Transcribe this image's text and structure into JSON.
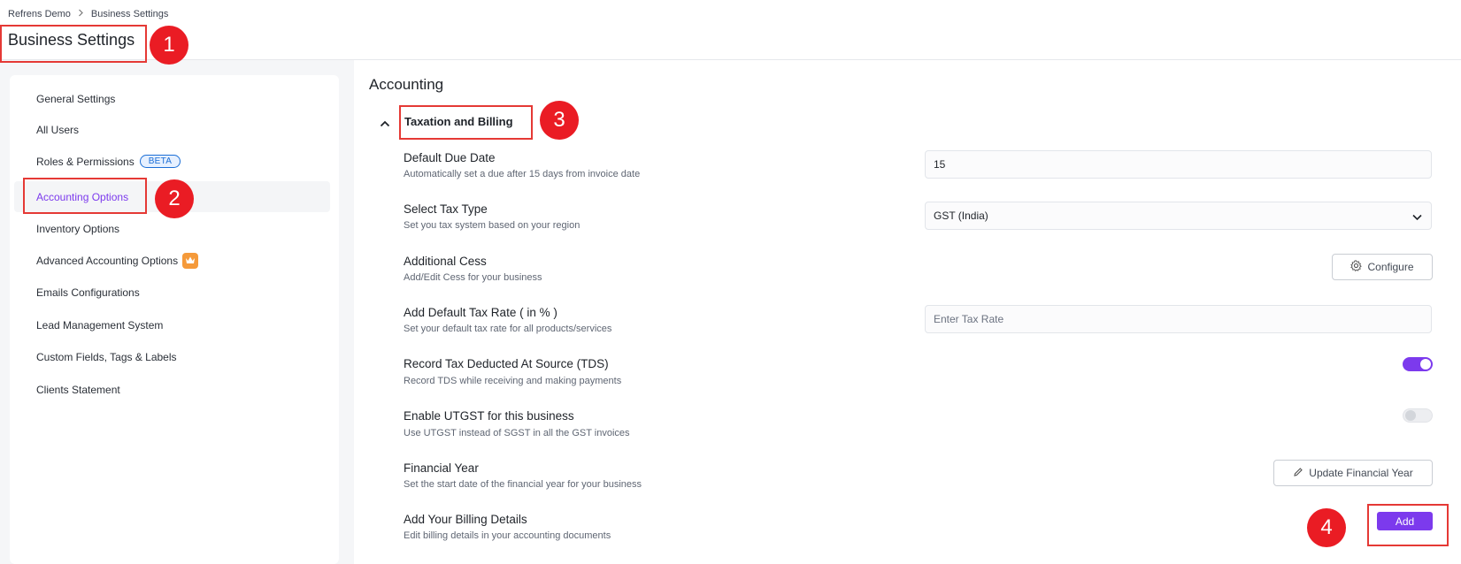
{
  "breadcrumb": {
    "root": "Refrens Demo",
    "current": "Business Settings"
  },
  "page_title": "Business Settings",
  "sidebar": {
    "items": [
      {
        "label": "General Settings"
      },
      {
        "label": "All Users"
      },
      {
        "label": "Roles & Permissions",
        "badge": "BETA"
      },
      {
        "label": "Accounting Options",
        "active": true
      },
      {
        "label": "Inventory Options"
      },
      {
        "label": "Advanced Accounting Options"
      },
      {
        "label": "Emails Configurations"
      },
      {
        "label": "Lead Management System"
      },
      {
        "label": "Custom Fields, Tags & Labels"
      },
      {
        "label": "Clients Statement"
      }
    ]
  },
  "main": {
    "section_title": "Accounting",
    "group_title": "Taxation and Billing",
    "rows": {
      "due_date": {
        "label": "Default Due Date",
        "desc": "Automatically set a due after 15 days from invoice date",
        "value": "15"
      },
      "tax_type": {
        "label": "Select Tax Type",
        "desc": "Set you tax system based on your region",
        "value": "GST (India)"
      },
      "cess": {
        "label": "Additional Cess",
        "desc": "Add/Edit Cess for your business",
        "button": "Configure"
      },
      "tax_rate": {
        "label": "Add Default Tax Rate ( in % )",
        "desc": "Set your default tax rate for all products/services",
        "placeholder": "Enter Tax Rate"
      },
      "tds": {
        "label": "Record Tax Deducted At Source (TDS)",
        "desc": "Record TDS while receiving and making payments"
      },
      "utgst": {
        "label": "Enable UTGST for this business",
        "desc": "Use UTGST instead of SGST in all the GST invoices"
      },
      "fy": {
        "label": "Financial Year",
        "desc": "Set the start date of the financial year for your business",
        "button": "Update Financial Year"
      },
      "billing": {
        "label": "Add Your Billing Details",
        "desc": "Edit billing details in your accounting documents",
        "button": "Add"
      }
    }
  },
  "annotations": [
    "1",
    "2",
    "3",
    "4"
  ],
  "colors": {
    "accent": "#7c3aed",
    "annotation": "#ea1c24",
    "badge": "#1b6ed6",
    "crown": "#f59a3a"
  }
}
